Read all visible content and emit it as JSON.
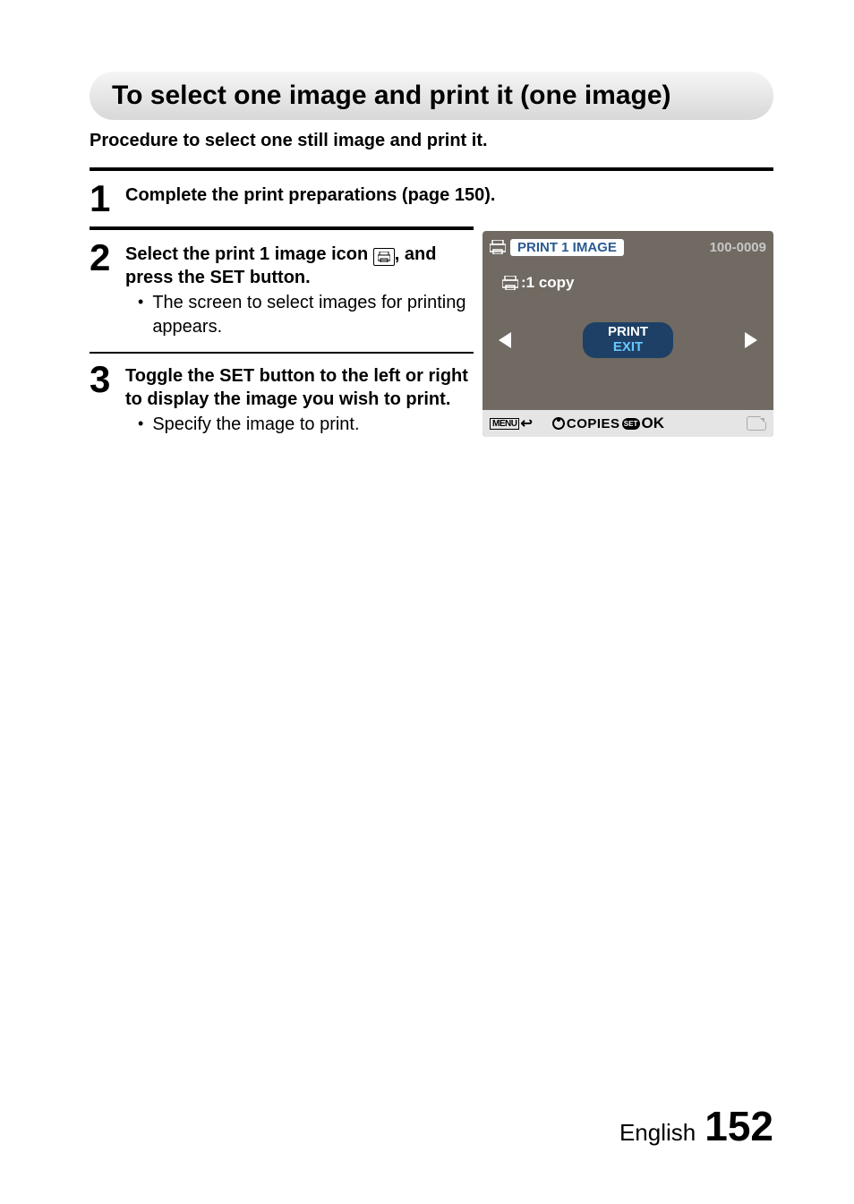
{
  "section_title": "To select one image and print it (one image)",
  "procedure_text": "Procedure to select one still image and print it.",
  "steps": {
    "s1": {
      "num": "1",
      "title": "Complete the print preparations (page 150)."
    },
    "s2": {
      "num": "2",
      "title_before": "Select the print 1 image icon ",
      "title_after": ", and press the SET button.",
      "bullet": "The screen to select images for printing appears."
    },
    "s3": {
      "num": "3",
      "title": "Toggle the SET button to the left or right to display the image you wish to print.",
      "bullet": "Specify the image to print."
    }
  },
  "screen": {
    "header_label": "PRINT 1 IMAGE",
    "image_number": "100-0009",
    "copy_text": ":1 copy",
    "print_label": "PRINT",
    "exit_label": "EXIT",
    "menu_label": "MENU",
    "copies_label": "COPIES",
    "set_label": "SET",
    "ok_label": "OK"
  },
  "footer": {
    "language": "English",
    "page": "152"
  }
}
